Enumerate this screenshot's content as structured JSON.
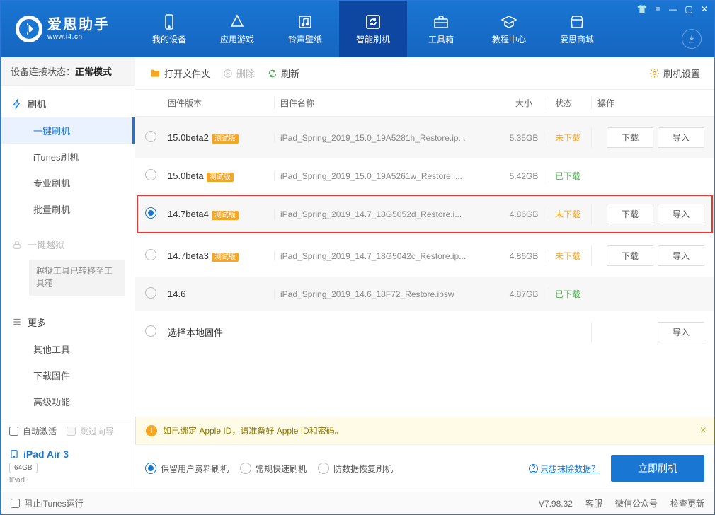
{
  "brand": {
    "title": "爱思助手",
    "sub": "www.i4.cn"
  },
  "nav": {
    "mydev": "我的设备",
    "apps": "应用游戏",
    "ring": "铃声壁纸",
    "flash": "智能刷机",
    "tools": "工具箱",
    "tut": "教程中心",
    "shop": "爱思商城"
  },
  "sidebar": {
    "conn_label": "设备连接状态：",
    "conn_value": "正常模式",
    "flash_head": "刷机",
    "items": {
      "onekey": "一键刷机",
      "itunes": "iTunes刷机",
      "pro": "专业刷机",
      "batch": "批量刷机"
    },
    "jb_head": "一键越狱",
    "jb_note": "越狱工具已转移至工具箱",
    "more_head": "更多",
    "more_items": {
      "other": "其他工具",
      "dl": "下载固件",
      "adv": "高级功能"
    },
    "auto_activate": "自动激活",
    "skip_wizard": "跳过向导",
    "device_name": "iPad Air 3",
    "device_cap": "64GB",
    "device_type": "iPad"
  },
  "toolbar": {
    "open": "打开文件夹",
    "del": "删除",
    "refresh": "刷新",
    "settings": "刷机设置"
  },
  "thead": {
    "ver": "固件版本",
    "name": "固件名称",
    "size": "大小",
    "status": "状态",
    "ops": "操作"
  },
  "btn": {
    "download": "下载",
    "import": "导入"
  },
  "status": {
    "no": "未下载",
    "yes": "已下载"
  },
  "local_fw": "选择本地固件",
  "rows": [
    {
      "ver": "15.0beta2",
      "beta": "测试版",
      "name": "iPad_Spring_2019_15.0_19A5281h_Restore.ip...",
      "size": "5.35GB",
      "status": "no",
      "ops": [
        "download",
        "import"
      ],
      "sel": false
    },
    {
      "ver": "15.0beta",
      "beta": "测试版",
      "name": "iPad_Spring_2019_15.0_19A5261w_Restore.i...",
      "size": "5.42GB",
      "status": "yes",
      "ops": [],
      "sel": false
    },
    {
      "ver": "14.7beta4",
      "beta": "测试版",
      "name": "iPad_Spring_2019_14.7_18G5052d_Restore.i...",
      "size": "4.86GB",
      "status": "no",
      "ops": [
        "download",
        "import"
      ],
      "sel": true,
      "highlight": true
    },
    {
      "ver": "14.7beta3",
      "beta": "测试版",
      "name": "iPad_Spring_2019_14.7_18G5042c_Restore.ip...",
      "size": "4.86GB",
      "status": "no",
      "ops": [
        "download",
        "import"
      ],
      "sel": false
    },
    {
      "ver": "14.6",
      "beta": null,
      "name": "iPad_Spring_2019_14.6_18F72_Restore.ipsw",
      "size": "4.87GB",
      "status": "yes",
      "ops": [],
      "sel": false
    }
  ],
  "alert": "如已绑定 Apple ID，请准备好 Apple ID和密码。",
  "flash_opts": {
    "keep": "保留用户资料刷机",
    "fast": "常规快速刷机",
    "recover": "防数据恢复刷机"
  },
  "flash_link": "只想抹除数据？",
  "flash_go": "立即刷机",
  "footer": {
    "block_itunes": "阻止iTunes运行",
    "ver": "V7.98.32",
    "cs": "客服",
    "wechat": "微信公众号",
    "upd": "检查更新"
  }
}
